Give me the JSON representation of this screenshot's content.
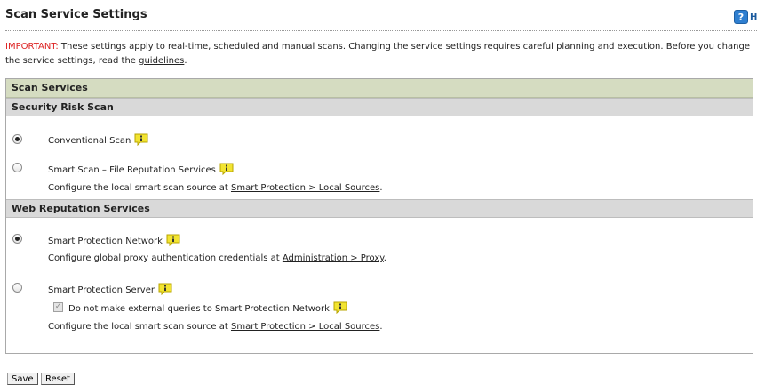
{
  "page": {
    "title": "Scan Service Settings",
    "help_label": "Help",
    "notice_prefix": "IMPORTANT:",
    "notice_text": " These settings apply to real-time, scheduled and manual scans. Changing the service settings requires careful planning and execution. Before you change the service settings, read the ",
    "notice_link": "guidelines",
    "notice_suffix": "."
  },
  "panel": {
    "header": "Scan Services",
    "security": {
      "header": "Security Risk Scan",
      "conventional_label": "Conventional Scan",
      "smart_label": "Smart Scan – File Reputation Services",
      "smart_desc_prefix": "Configure the local smart scan source at ",
      "smart_desc_link": "Smart Protection > Local Sources",
      "smart_desc_suffix": "."
    },
    "web": {
      "header": "Web Reputation Services",
      "network_label": "Smart Protection Network",
      "network_desc_prefix": "Configure global proxy authentication credentials at ",
      "network_desc_link": "Administration > Proxy",
      "network_desc_suffix": ".",
      "server_label": "Smart Protection Server",
      "no_external_label": "Do not make external queries to Smart Protection Network",
      "server_desc_prefix": "Configure the local smart scan source at ",
      "server_desc_link": "Smart Protection > Local Sources",
      "server_desc_suffix": "."
    }
  },
  "buttons": {
    "save": "Save",
    "reset": "Reset"
  },
  "state": {
    "security_scan_selected": "Conventional Scan",
    "web_reputation_selected": "Smart Protection Network",
    "no_external_checked": true,
    "no_external_disabled": true
  },
  "colors": {
    "important": "#dd2222",
    "section_header": "#d5dcc1",
    "subsection_header": "#d9d9d9",
    "help_icon": "#2f7fd0",
    "info_icon": "#f2e431"
  }
}
